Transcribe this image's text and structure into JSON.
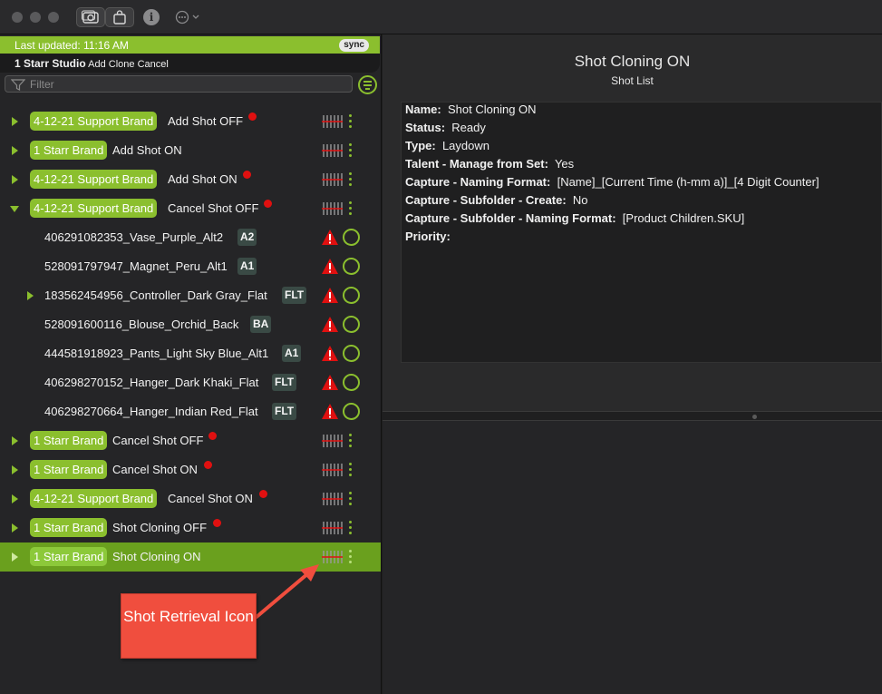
{
  "titlebar": {
    "icons": [
      "close-icon",
      "minimize-icon",
      "zoom-icon",
      "camera-icon",
      "bag-icon",
      "info-icon",
      "more-options-icon"
    ],
    "info_glyph": "i"
  },
  "sync_bar": {
    "last_updated": "Last updated: 11:16 AM",
    "sync_label": "sync",
    "studio_name": "1 Starr Studio",
    "studio_actions": "Add Clone Cancel"
  },
  "filter": {
    "placeholder": "Filter"
  },
  "list": {
    "rows": [
      {
        "brand": "4-12-21 Support Brand",
        "name": "Add Shot OFF"
      },
      {
        "brand": "1 Starr Brand",
        "name": "Add Shot ON"
      },
      {
        "brand": "4-12-21 Support Brand",
        "name": "Add Shot ON"
      },
      {
        "brand": "4-12-21 Support Brand",
        "name": "Cancel Shot OFF"
      },
      {
        "name": "406291082353_Vase_Purple_Alt2",
        "badge": "A2"
      },
      {
        "name": "528091797947_Magnet_Peru_Alt1",
        "badge": "A1"
      },
      {
        "name": "183562454956_Controller_Dark Gray_Flat",
        "badge": "FLT"
      },
      {
        "name": "528091600116_Blouse_Orchid_Back",
        "badge": "BA"
      },
      {
        "name": "444581918923_Pants_Light Sky Blue_Alt1",
        "badge": "A1"
      },
      {
        "name": "406298270152_Hanger_Dark Khaki_Flat",
        "badge": "FLT"
      },
      {
        "name": "406298270664_Hanger_Indian Red_Flat",
        "badge": "FLT"
      },
      {
        "brand": "1 Starr Brand",
        "name": "Cancel Shot OFF"
      },
      {
        "brand": "1 Starr Brand",
        "name": "Cancel Shot ON"
      },
      {
        "brand": "4-12-21 Support Brand",
        "name": "Cancel Shot ON"
      },
      {
        "brand": "1 Starr Brand",
        "name": "Shot Cloning OFF"
      },
      {
        "brand": "1 Starr Brand",
        "name": "Shot Cloning ON"
      }
    ]
  },
  "detail": {
    "title": "Shot Cloning ON",
    "subtitle": "Shot List",
    "fields": [
      {
        "label": "Name:",
        "value": "Shot Cloning ON"
      },
      {
        "label": "Status:",
        "value": "Ready"
      },
      {
        "label": "Type:",
        "value": "Laydown"
      },
      {
        "label": "Talent - Manage from Set:",
        "value": "Yes"
      },
      {
        "label": "Capture - Naming Format:",
        "value": "[Name]_[Current Time (h-mm a)]_[4 Digit Counter]"
      },
      {
        "label": "Capture - Subfolder - Create:",
        "value": "No"
      },
      {
        "label": "Capture - Subfolder - Naming Format:",
        "value": "[Product Children.SKU]"
      },
      {
        "label": "Priority:",
        "value": ""
      }
    ]
  },
  "annotation": {
    "callout_text": "Shot Retrieval Icon"
  },
  "colors": {
    "accent_green": "#8bbf2e",
    "selected_row": "#6aa01e",
    "alert_red": "#e01010",
    "callout_red": "#f04e3e"
  }
}
